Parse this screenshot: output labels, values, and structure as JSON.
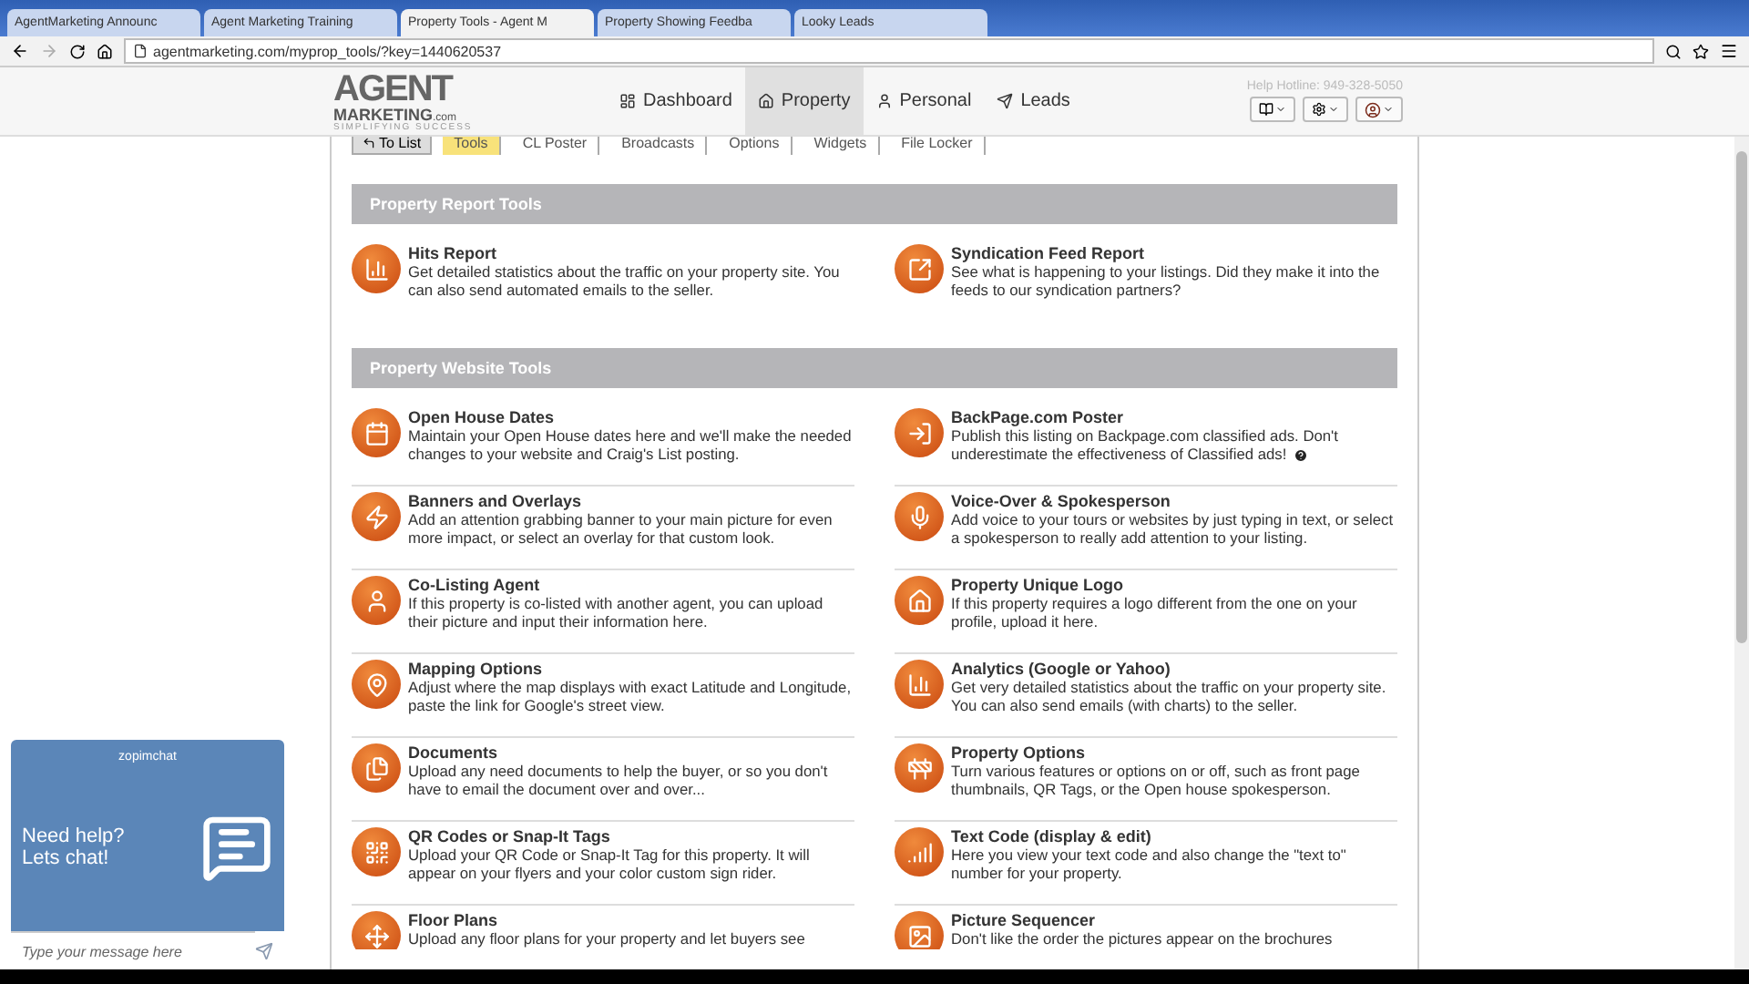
{
  "browser": {
    "tabs": [
      {
        "title": "AgentMarketing Announc",
        "selected": false
      },
      {
        "title": "Agent Marketing Training",
        "selected": false
      },
      {
        "title": "Property Tools - Agent M",
        "selected": true
      },
      {
        "title": "Property Showing Feedba",
        "selected": false
      },
      {
        "title": "Looky Leads",
        "selected": false
      }
    ],
    "url": "agentmarketing.com/myprop_tools/?key=1440620537"
  },
  "header": {
    "logo_main": "AGENT",
    "logo_sub": "MARKETING",
    "logo_dotcom": ".com",
    "logo_tagline": "SIMPLIFYING SUCCESS",
    "help_hotline": "Help Hotline: 949-328-5050",
    "nav": [
      {
        "label": "Dashboard",
        "selected": false
      },
      {
        "label": "Property",
        "selected": true
      },
      {
        "label": "Personal",
        "selected": false
      },
      {
        "label": "Leads",
        "selected": false
      }
    ]
  },
  "subnav": {
    "back_button": "To List",
    "tabs": [
      {
        "label": "Tools",
        "selected": true
      },
      {
        "label": "CL Poster",
        "selected": false
      },
      {
        "label": "Broadcasts",
        "selected": false
      },
      {
        "label": "Options",
        "selected": false
      },
      {
        "label": "Widgets",
        "selected": false
      },
      {
        "label": "File Locker",
        "selected": false
      }
    ]
  },
  "sections": [
    {
      "title": "Property Report Tools",
      "items": [
        {
          "title": "Hits Report",
          "description": "Get detailed statistics about the traffic on your property site. You can also send automated emails to the seller."
        },
        {
          "title": "Syndication Feed Report",
          "description": "See what is happening to your listings. Did they make it into the feeds to our syndication partners?"
        }
      ]
    },
    {
      "title": "Property Website Tools",
      "items": [
        {
          "title": "Open House Dates",
          "description": "Maintain your Open House dates here and we'll make the needed changes to your website and Craig's List posting."
        },
        {
          "title": "BackPage.com Poster",
          "description": "Publish this listing on Backpage.com classified ads. Don't underestimate the effectiveness of Classified ads!",
          "help": true
        },
        {
          "title": "Banners and Overlays",
          "description": "Add an attention grabbing banner to your main picture for even more impact, or select an overlay for that custom look."
        },
        {
          "title": "Voice-Over & Spokesperson",
          "description": "Add voice to your tours or websites by just typing in text, or select a spokesperson to really add attention to your listing."
        },
        {
          "title": "Co-Listing Agent",
          "description": "If this property is co-listed with another agent, you can upload their picture and input their information here."
        },
        {
          "title": "Property Unique Logo",
          "description": "If this property requires a logo different from the one on your profile, upload it here."
        },
        {
          "title": "Mapping Options",
          "description": "Adjust where the map displays with exact Latitude and Longitude, paste the link for Google's street view."
        },
        {
          "title": "Analytics (Google or Yahoo)",
          "description": "Get very detailed statistics about the traffic on your property site. You can also send emails (with charts) to the seller."
        },
        {
          "title": "Documents",
          "description": "Upload any need documents to help the buyer, or so you don't have to email the document over and over..."
        },
        {
          "title": "Property Options",
          "description": "Turn various features or options on or off, such as front page thumbnails, QR Tags, or the Open house spokesperson."
        },
        {
          "title": "QR Codes or Snap-It Tags",
          "description": "Upload your QR Code or Snap-It Tag for this property. It will appear on your flyers and your color custom sign rider."
        },
        {
          "title": "Text Code (display & edit)",
          "description": "Here you view your text code and also change the \"text to\" number for your property."
        },
        {
          "title": "Floor Plans",
          "description": "Upload any floor plans for your property and let buyers see"
        },
        {
          "title": "Picture Sequencer",
          "description": "Don't like the order the pictures appear on the brochures"
        }
      ]
    }
  ],
  "chat": {
    "brand": "zopimchat",
    "greeting": "Need help? Lets chat!",
    "placeholder": "Type your message here"
  }
}
